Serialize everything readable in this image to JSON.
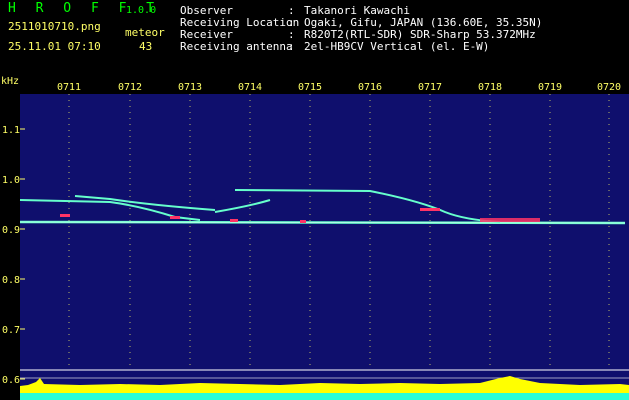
{
  "app": {
    "logo": "H R O F F T",
    "version": "1.0.0",
    "filename": "2511010710.png",
    "datetime": "25.11.01 07:10",
    "meteor_label": "meteor",
    "meteor_count": "43"
  },
  "info": [
    {
      "key": "Observer",
      "value": "Takanori Kawachi"
    },
    {
      "key": "Receiving Location",
      "value": "Ogaki, Gifu, JAPAN (136.60E, 35.35N)"
    },
    {
      "key": "Receiver",
      "value": "R820T2(RTL-SDR) SDR-Sharp 53.372MHz"
    },
    {
      "key": "Receiving antenna",
      "value": "2el-HB9CV Vertical (el. E-W)"
    }
  ],
  "separator": ":",
  "spectrogram": {
    "unit_label": "kHz",
    "time_ticks": [
      "0711",
      "0712",
      "0713",
      "0714",
      "0715",
      "0716",
      "0717",
      "0718",
      "0719",
      "0720"
    ],
    "freq_ticks": [
      "1.1",
      "1.0",
      "0.9",
      "0.8",
      "0.7",
      "0.6"
    ],
    "colors": {
      "background": "#0a0a5a",
      "label": "#ffff66",
      "trace": "#66ffcc",
      "hot": "#ff3366",
      "bars": "#ffff00",
      "cyan": "#00ffff"
    }
  }
}
